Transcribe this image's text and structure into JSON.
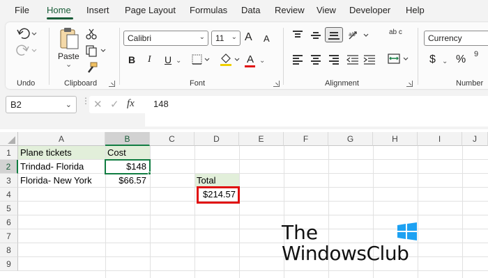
{
  "menu": {
    "tabs": [
      {
        "label": "File"
      },
      {
        "label": "Home"
      },
      {
        "label": "Insert"
      },
      {
        "label": "Page Layout"
      },
      {
        "label": "Formulas"
      },
      {
        "label": "Data"
      },
      {
        "label": "Review"
      },
      {
        "label": "View"
      },
      {
        "label": "Developer"
      },
      {
        "label": "Help"
      }
    ],
    "active": "Home"
  },
  "ribbon": {
    "undo": {
      "label": "Undo",
      "undo_icon": "undo-icon",
      "redo_icon": "redo-icon"
    },
    "clipboard": {
      "label": "Clipboard",
      "paste_label": "Paste",
      "paste_arrow": "⌄"
    },
    "font": {
      "label": "Font",
      "family": "Calibri",
      "size": "11",
      "bold": "B",
      "italic": "I",
      "underline": "U",
      "font_color_letter": "A",
      "font_color": "#e01010",
      "grow_letter": "A",
      "shrink_letter": "A"
    },
    "alignment": {
      "label": "Alignment",
      "wrap_label": "ab c"
    },
    "number": {
      "label": "Number",
      "format": "Currency",
      "currency_symbol": "$",
      "percent_symbol": "%"
    }
  },
  "formula_bar": {
    "name_box": "B2",
    "fx": "fx",
    "cancel": "✕",
    "enter": "✓",
    "value": "148"
  },
  "sheet": {
    "columns": [
      "A",
      "B",
      "C",
      "D",
      "E",
      "F",
      "G",
      "H",
      "I",
      "J"
    ],
    "rows": [
      "1",
      "2",
      "3",
      "4",
      "5",
      "6",
      "7",
      "8",
      "9"
    ],
    "selected_cell": "B2",
    "cells": {
      "A1": "Plane tickets",
      "B1": "Cost",
      "A2": "Trindad- Florida",
      "B2": "$148",
      "A3": "Florida- New York",
      "B3": "$66.57",
      "D3": "Total",
      "D4": "$214.57"
    },
    "fill_color": "#e2efda",
    "accent_color": "#107c41",
    "highlight_color": "#e01010"
  },
  "watermark": {
    "line1": "The",
    "line2": "WindowsClub"
  }
}
